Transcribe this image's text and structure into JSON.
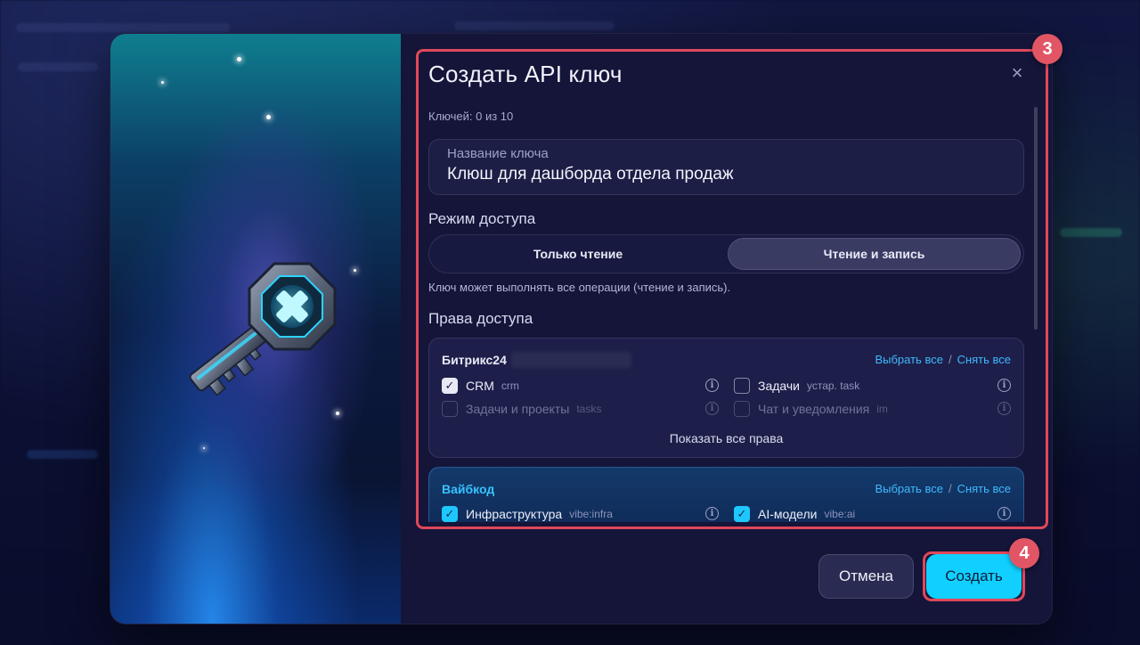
{
  "dialog": {
    "title": "Создать API ключ",
    "close_glyph": "×",
    "counter": "Ключей: 0 из 10"
  },
  "key_name_field": {
    "label": "Название ключа",
    "value": "Клюш для дашборда отдела продаж"
  },
  "access_mode": {
    "heading": "Режим доступа",
    "options": [
      "Только чтение",
      "Чтение и запись"
    ],
    "selected": "Чтение и запись",
    "hint": "Ключ может выполнять все операции (чтение и запись)."
  },
  "permissions": {
    "heading": "Права доступа",
    "select_all": "Выбрать все",
    "separator": "/",
    "deselect_all": "Снять все",
    "groups": [
      {
        "title": "Битрикс24",
        "items": [
          {
            "name": "CRM",
            "code": "crm",
            "checked": true
          },
          {
            "name": "Задачи",
            "code": "устар.  task",
            "checked": false
          },
          {
            "name": "Задачи и проекты",
            "code": "tasks",
            "checked": false
          },
          {
            "name": "Чат и уведомления",
            "code": "im",
            "checked": false
          }
        ],
        "show_all": "Показать все права"
      },
      {
        "title": "Вайбкод",
        "items": [
          {
            "name": "Инфраструктура",
            "code": "vibe:infra",
            "checked": true
          },
          {
            "name": "AI-модели",
            "code": "vibe:ai",
            "checked": true
          }
        ]
      }
    ]
  },
  "footer": {
    "cancel": "Отмена",
    "create": "Создать"
  },
  "annotations": {
    "step_3": "3",
    "step_4": "4"
  },
  "icons": {
    "check": "✓",
    "info": "i",
    "hero": "key-icon"
  },
  "colors": {
    "accent_cyan": "#11d0ff",
    "highlight_red": "#e0485a",
    "link_blue": "#3fb9ff"
  }
}
